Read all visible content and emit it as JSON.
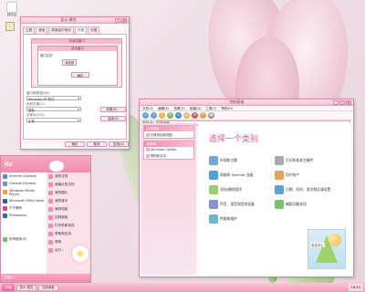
{
  "desktop": {
    "icon_label": "回收站"
  },
  "display_dialog": {
    "title": "显示 属性",
    "tabs": [
      "主题",
      "桌面",
      "屏幕保护程序",
      "外观",
      "设置"
    ],
    "preview_title": "非活动窗口",
    "preview_inner_title": "活动窗口",
    "preview_item1": "窗口文字",
    "preview_item2": "消息框",
    "preview_button": "确定",
    "label_style": "窗口和按钮(W):",
    "value_style": "Windows XP 样式",
    "label_color": "色彩方案(C):",
    "value_color": "银色",
    "label_font": "字体大小(F):",
    "value_font": "正常",
    "btn_effects": "效果(E)...",
    "btn_advanced": "高级(D)",
    "btn_ok": "确定",
    "btn_cancel": "取消",
    "btn_apply": "应用(A)"
  },
  "control_panel": {
    "title": "控制面板",
    "menu": [
      "文件(F)",
      "编辑(E)",
      "查看(V)",
      "收藏(A)",
      "工具(T)",
      "帮助(H)"
    ],
    "address_label": "地址(D)",
    "address_value": "控制面板",
    "side_head1": "控制面板",
    "side_link1": "切换到经典视图",
    "side_head2": "请参阅",
    "side_link2": "Windows Update",
    "side_link3": "帮助和支持",
    "heading": "选择一个类别",
    "categories": [
      "外观和主题",
      "网络和 Internet 连接",
      "添加/删除程序",
      "声音、语音和音频设备",
      "性能和维护",
      "打印机和其它硬件",
      "用户帐户",
      "日期、时间、语言和区域设置",
      "辅助功能选项",
      "安全中心"
    ],
    "picture_label": "安全中心"
  },
  "start_menu": {
    "user": "Oz",
    "left_items": [
      "Internet Explorer",
      "Outlook Express",
      "Windows Media Player",
      "Microsoft Office Word",
      "千千静听",
      "Photoshop",
      "所有程序(P)"
    ],
    "right_items": [
      "我的文档",
      "我最近的文档",
      "我的图片",
      "我的音乐",
      "我的电脑",
      "控制面板",
      "打印机和传真",
      "帮助和支持",
      "搜索",
      "运行..."
    ],
    "logoff": "注销(L)"
  },
  "taskbar": {
    "start": "开始",
    "tasks": [
      "显示 属性",
      "控制面板"
    ],
    "clock": "18:43"
  },
  "colors": {
    "accent": "#f28cb0",
    "heading": "#e0569a",
    "window_border": "#d88aa6"
  }
}
